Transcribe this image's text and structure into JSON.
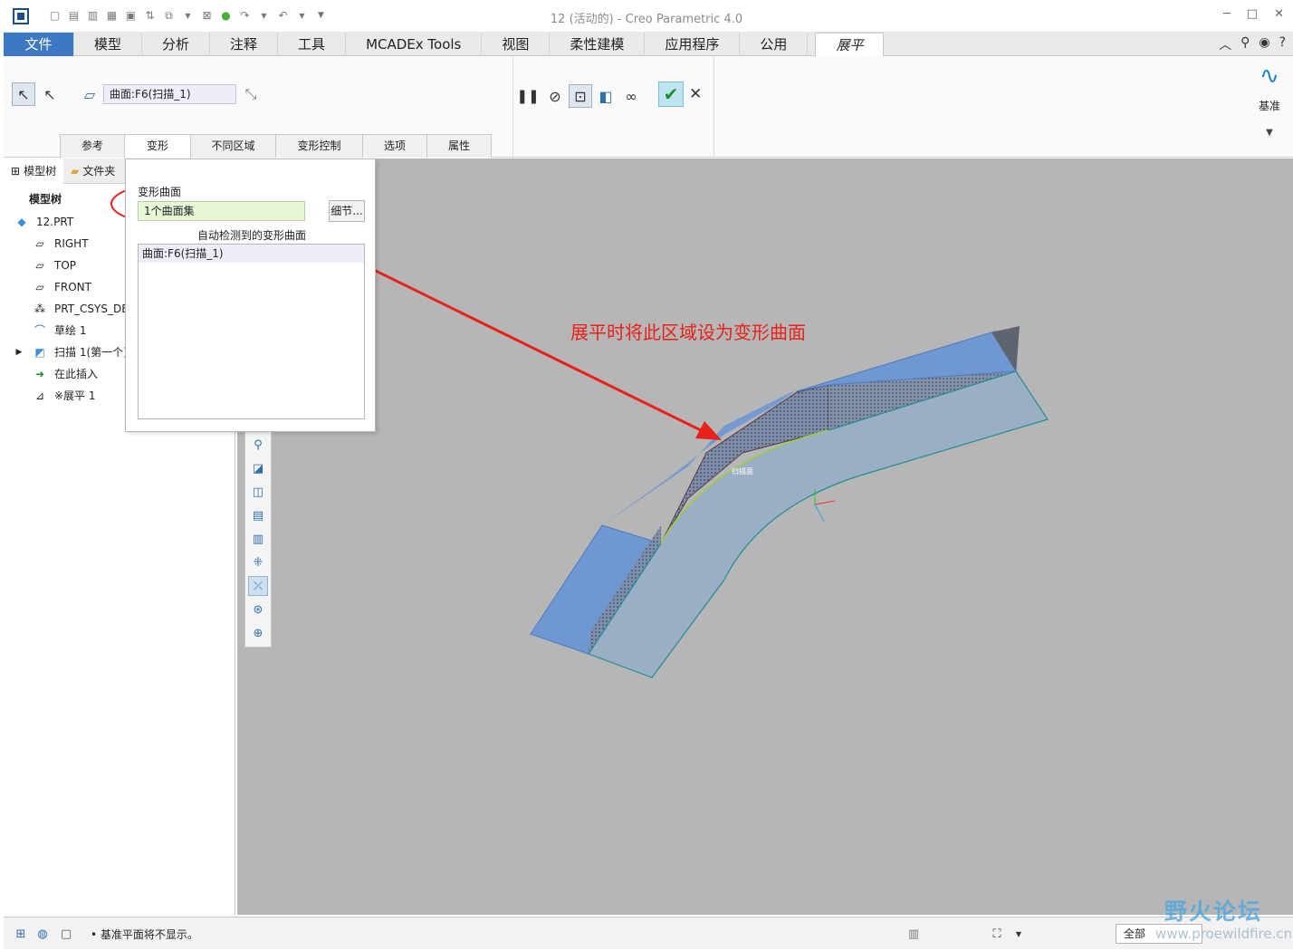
{
  "window": {
    "title": "12 (活动的) - Creo Parametric 4.0"
  },
  "ribbon_tabs": {
    "file": "文件",
    "items": [
      "模型",
      "分析",
      "注释",
      "工具",
      "MCADEx Tools",
      "视图",
      "柔性建模",
      "应用程序",
      "公用"
    ],
    "active": "展平"
  },
  "ribbon": {
    "surface_field": "曲面:F6(扫描_1)",
    "datum_label": "基准",
    "subtabs": [
      "参考",
      "变形",
      "不同区域",
      "变形控制",
      "选项",
      "属性"
    ]
  },
  "left_panel": {
    "tab_model_tree": "模型树",
    "tab_folder": "文件夹",
    "header": "模型树",
    "tree": [
      {
        "label": "12.PRT",
        "icon": "part-icon",
        "color": "#3b8fd4"
      },
      {
        "label": "RIGHT",
        "icon": "datum-plane-icon",
        "color": "#333333"
      },
      {
        "label": "TOP",
        "icon": "datum-plane-icon",
        "color": "#333333"
      },
      {
        "label": "FRONT",
        "icon": "datum-plane-icon",
        "color": "#333333"
      },
      {
        "label": "PRT_CSYS_DEF",
        "icon": "csys-icon",
        "color": "#333333"
      },
      {
        "label": "草绘 1",
        "icon": "sketch-icon",
        "color": "#2e6fae"
      },
      {
        "label": "扫描 1(第一个)",
        "icon": "sweep-icon",
        "color": "#3b8fd4"
      },
      {
        "label": "在此插入",
        "icon": "insert-here-icon",
        "color": "#1e8f2a"
      },
      {
        "label": "※展平 1",
        "icon": "flatten-icon",
        "color": "#333333"
      }
    ]
  },
  "deform_panel": {
    "title": "变形曲面",
    "field_value": "1个曲面集",
    "details_button": "细节...",
    "auto_detect_label": "自动检测到的变形曲面",
    "list_items": [
      "曲面:F6(扫描_1)"
    ]
  },
  "viewport": {
    "annotation": "展平时将此区域设为变形曲面",
    "annotation_color": "#e8211b",
    "model_label": "扫描面"
  },
  "status_bar": {
    "message": "• 基准平面将不显示。",
    "filter_value": "全部"
  },
  "watermark": {
    "line1": "野火论坛",
    "line2": "www.proewildfire.cn"
  }
}
